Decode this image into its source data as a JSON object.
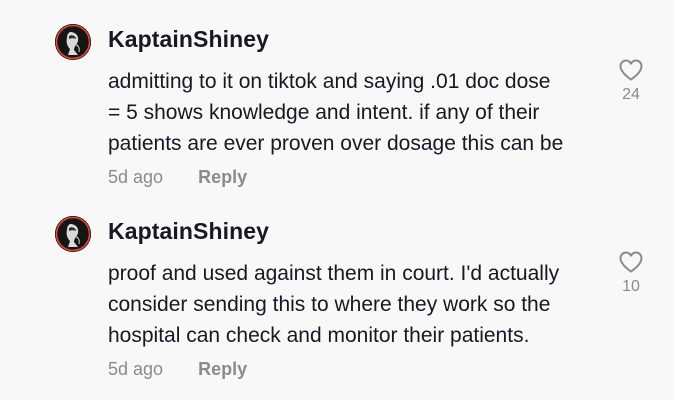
{
  "comments": [
    {
      "username": "KaptainShiney",
      "lines": [
        "admitting to it on tiktok and saying .01 doc dose",
        "= 5 shows knowledge and intent. if any of their",
        "patients are ever proven over dosage this can be"
      ],
      "timestamp": "5d ago",
      "reply_label": "Reply",
      "like_count": "24",
      "avatar_icon": "profile-avatar-image"
    },
    {
      "username": "KaptainShiney",
      "lines": [
        "proof and used against them in court. I'd actually",
        "consider sending this to where they work so the",
        "hospital can check and monitor their patients."
      ],
      "timestamp": "5d ago",
      "reply_label": "Reply",
      "like_count": "10",
      "avatar_icon": "profile-avatar-image"
    }
  ],
  "colors": {
    "background": "#f8f8f8",
    "primary_text": "#161823",
    "secondary_text": "#8a8b91",
    "avatar_ring": "#e8453c"
  }
}
